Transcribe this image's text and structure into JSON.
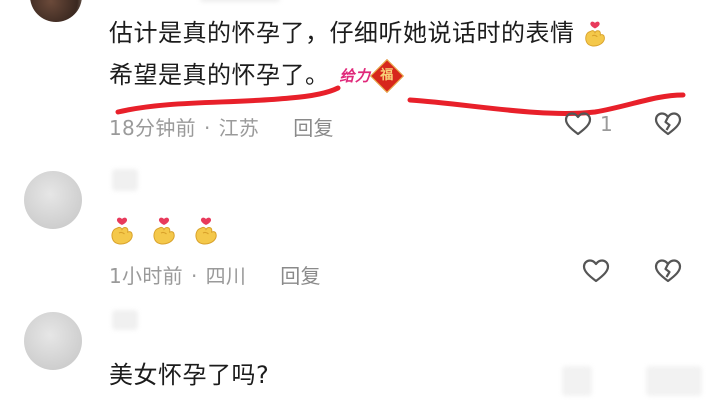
{
  "comments": [
    {
      "line1": "估计是真的怀孕了，仔细听她说话时的表情",
      "line2": "希望是真的怀孕了。",
      "sticker_label": "给力",
      "badge_char": "福",
      "time": "18分钟前",
      "location": "江苏",
      "reply": "回复",
      "like_count": "1"
    },
    {
      "time": "1小时前",
      "location": "四川",
      "reply": "回复"
    },
    {
      "line1": "美女怀孕了吗?"
    }
  ],
  "meta_separator": "·",
  "icons": [
    "heart-outline-icon",
    "broken-heart-icon",
    "love-hand-emoji"
  ],
  "colors": {
    "underline": "#e8202a",
    "meta": "#9a9a9a",
    "text": "#1c1c1c"
  }
}
